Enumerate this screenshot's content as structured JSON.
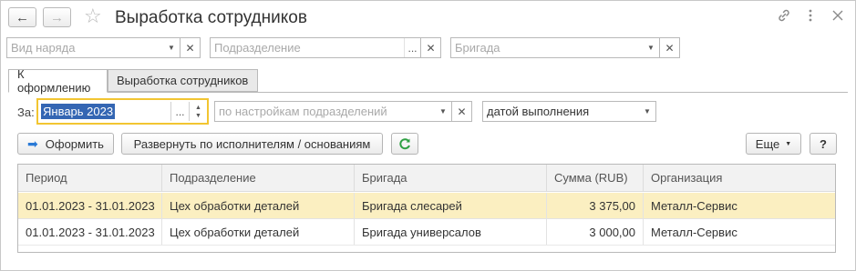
{
  "window": {
    "title": "Выработка сотрудников"
  },
  "filters": {
    "work_order_type": {
      "placeholder": "Вид наряда"
    },
    "department": {
      "placeholder": "Подразделение"
    },
    "brigade": {
      "placeholder": "Бригада"
    }
  },
  "tabs": [
    {
      "label": "К оформлению",
      "active": true
    },
    {
      "label": "Выработка сотрудников",
      "active": false
    }
  ],
  "period": {
    "label": "За:",
    "value": "Январь 2023"
  },
  "dept_settings": {
    "placeholder": "по настройкам подразделений"
  },
  "date_mode": {
    "value": "датой выполнения"
  },
  "toolbar": {
    "process_label": "Оформить",
    "expand_label": "Развернуть по исполнителям / основаниям",
    "more_label": "Еще",
    "help_label": "?"
  },
  "table": {
    "columns": [
      "Период",
      "Подразделение",
      "Бригада",
      "Сумма (RUB)",
      "Организация"
    ],
    "rows": [
      {
        "period": "01.01.2023 - 31.01.2023",
        "department": "Цех обработки деталей",
        "brigade": "Бригада слесарей",
        "sum": "3 375,00",
        "organization": "Металл-Сервис",
        "selected": true
      },
      {
        "period": "01.01.2023 - 31.01.2023",
        "department": "Цех обработки деталей",
        "brigade": "Бригада универсалов",
        "sum": "3 000,00",
        "organization": "Металл-Сервис",
        "selected": false
      }
    ]
  },
  "icons": {
    "back": "arrow-left-icon",
    "forward": "arrow-right-icon",
    "favorite": "star-icon",
    "link": "link-icon",
    "menu": "more-vertical-icon",
    "close": "close-icon",
    "refresh": "refresh-icon"
  },
  "colors": {
    "selected_row": "#fbefc1",
    "focus_border": "#f2c531",
    "selection": "#3466b3",
    "refresh_icon": "#2ea043"
  }
}
